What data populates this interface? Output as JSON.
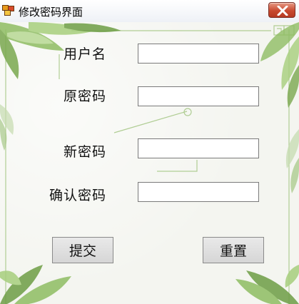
{
  "window": {
    "title": "修改密码界面",
    "close_icon": "close-x-icon",
    "app_icon": "form-icon"
  },
  "form": {
    "username": {
      "label": "用户名",
      "value": ""
    },
    "old_password": {
      "label": "原密码",
      "value": ""
    },
    "new_password": {
      "label": "新密码",
      "value": ""
    },
    "confirm_password": {
      "label": "确认密码",
      "value": ""
    }
  },
  "buttons": {
    "submit_label": "提交",
    "reset_label": "重置"
  },
  "colors": {
    "leaf_green": "#7fae55",
    "frame_line": "#a9c98a",
    "close_red": "#c8492f"
  }
}
